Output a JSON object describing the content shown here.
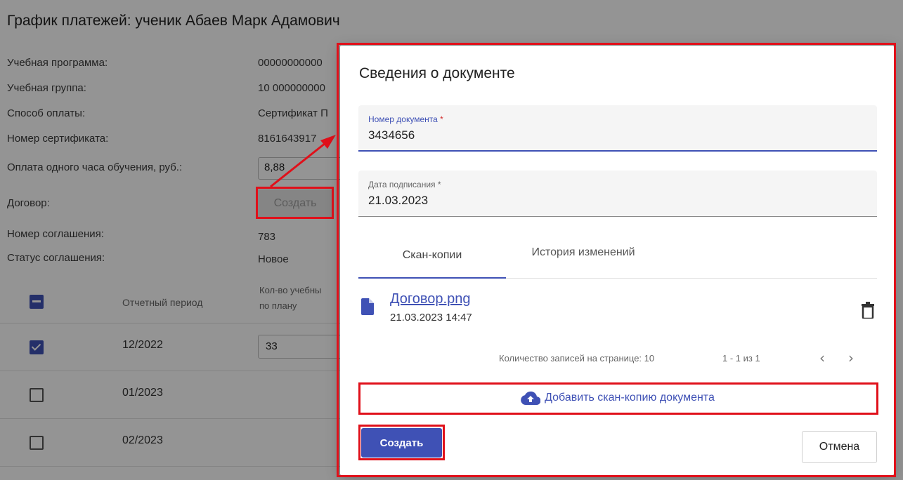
{
  "page": {
    "title": "График платежей: ученик Абаев Марк Адамович",
    "fields": [
      {
        "label": "Учебная программа:",
        "value": "00000000000"
      },
      {
        "label": "Учебная группа:",
        "value": "10 000000000"
      },
      {
        "label": "Способ оплаты:",
        "value": "Сертификат П"
      },
      {
        "label": "Номер сертификата:",
        "value": "8161643917"
      },
      {
        "label": "Оплата одного часа обучения, руб.:",
        "value": "8,88"
      },
      {
        "label": "Договор:",
        "value": "Создать"
      },
      {
        "label": "Номер соглашения:",
        "value": "783"
      },
      {
        "label": "Статус соглашения:",
        "value": "Новое"
      }
    ],
    "schedule": {
      "headers": {
        "period": "Отчетный период",
        "hours_line1": "Кол-во учебны",
        "hours_line2": "по плану"
      },
      "rows": [
        {
          "period": "12/2022",
          "hours": "33",
          "checked": true
        },
        {
          "period": "01/2023",
          "hours": "",
          "checked": false
        },
        {
          "period": "02/2023",
          "hours": "",
          "checked": false
        }
      ]
    }
  },
  "dialog": {
    "title": "Сведения о документе",
    "doc_number": {
      "label": "Номер документа",
      "required_mark": "*",
      "value": "3434656"
    },
    "sign_date": {
      "label": "Дата подписания *",
      "value": "21.03.2023"
    },
    "tabs": [
      {
        "label": "Скан-копии",
        "active": true
      },
      {
        "label": "История изменений",
        "active": false
      }
    ],
    "files": [
      {
        "name": "Договор.png",
        "date": "21.03.2023 14:47"
      }
    ],
    "pager": {
      "per_page_label": "Количество записей на странице: 10",
      "range": "1 - 1 из 1"
    },
    "upload_label": "Добавить скан-копию документа",
    "create_label": "Создать",
    "cancel_label": "Отмена"
  },
  "colors": {
    "primary": "#3f51b5",
    "highlight": "#e0101a",
    "required": "#d32f2f"
  },
  "icons": [
    "checkbox-icon",
    "file-icon",
    "trash-icon",
    "cloud-upload-icon",
    "chevron-left-icon",
    "chevron-right-icon"
  ]
}
